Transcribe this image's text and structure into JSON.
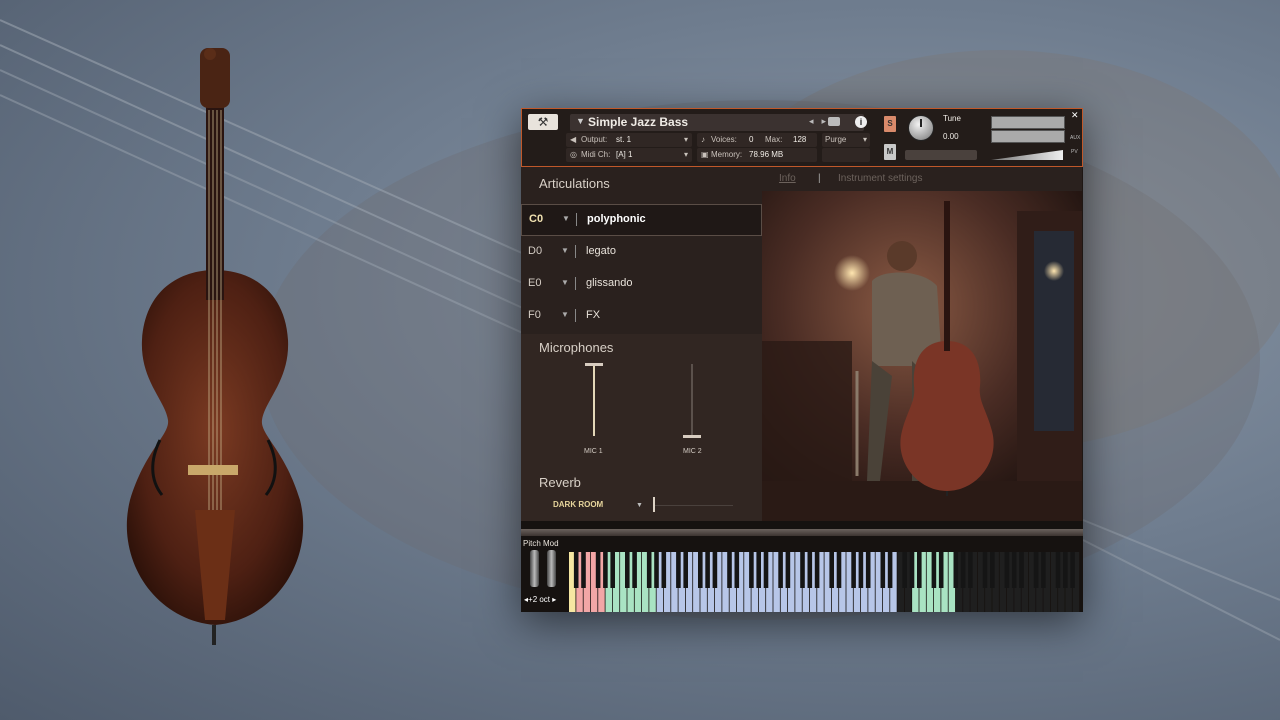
{
  "plugin": {
    "header": {
      "instrument_name": "Simple Jazz Bass",
      "output_label": "Output:",
      "output_value": "st. 1",
      "midi_label": "Midi Ch:",
      "midi_value": "[A] 1",
      "voices_label": "Voices:",
      "voices_value": "0",
      "max_label": "Max:",
      "max_value": "128",
      "memory_label": "Memory:",
      "memory_value": "78.96 MB",
      "purge_label": "Purge",
      "solo_label": "S",
      "mute_label": "M",
      "tune_label": "Tune",
      "tune_value": "0.00",
      "aux_label": "AUX",
      "pv_label": "PV"
    },
    "articulations": {
      "title": "Articulations",
      "items": [
        {
          "key": "C0",
          "label": "polyphonic"
        },
        {
          "key": "D0",
          "label": "legato"
        },
        {
          "key": "E0",
          "label": "glissando"
        },
        {
          "key": "F0",
          "label": "FX"
        }
      ]
    },
    "microphones": {
      "title": "Microphones",
      "mic1_label": "MIC 1",
      "mic2_label": "MIC 2",
      "mic1_level": 1.0,
      "mic2_level": 0.0
    },
    "reverb": {
      "title": "Reverb",
      "preset": "DARK ROOM"
    },
    "tabs": {
      "info": "Info",
      "instrument_settings": "Instrument settings"
    },
    "keyboard": {
      "pitch_mod_label": "Pitch Mod",
      "octave_label": "◂+2 oct ▸"
    }
  },
  "colors": {
    "accent": "#c0582a",
    "active_key_text": "#f2e3b2",
    "reverb_text": "#e7d59c",
    "key_yellow": "#f6e7a2",
    "key_red": "#f2a6a6",
    "key_green": "#a9e3c3",
    "key_blue": "#b7c6e8"
  }
}
